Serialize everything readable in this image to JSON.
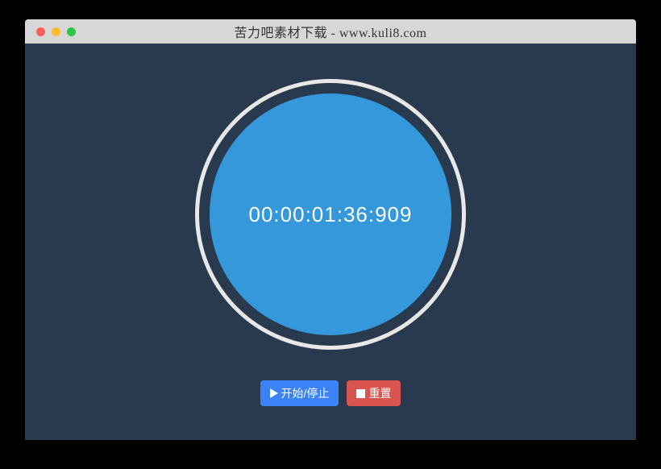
{
  "window": {
    "title": "苦力吧素材下载 - www.kuli8.com"
  },
  "timer": {
    "display": "00:00:01:36:909"
  },
  "controls": {
    "start_stop_label": "开始/停止",
    "reset_label": "重置"
  }
}
